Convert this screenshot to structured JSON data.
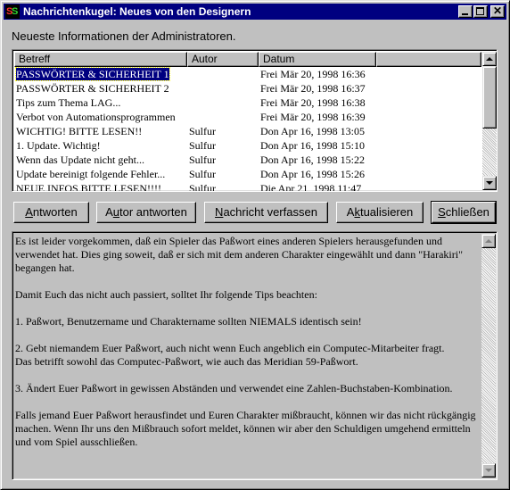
{
  "window": {
    "title": "Nachrichtenkugel: Neues von den Designern",
    "icon": "app-icon",
    "controls": [
      "minimize",
      "maximize",
      "close"
    ]
  },
  "intro": "Neueste Informationen der Administratoren.",
  "list": {
    "columns": [
      "Betreff",
      "Autor",
      "Datum"
    ],
    "rows": [
      {
        "subject": "PASSWÖRTER & SICHERHEIT 1",
        "author": "",
        "date": "Frei Mär 20, 1998 16:36",
        "selected": true
      },
      {
        "subject": "PASSWÖRTER & SICHERHEIT 2",
        "author": "",
        "date": "Frei Mär 20, 1998 16:37"
      },
      {
        "subject": "Tips zum Thema LAG...",
        "author": "",
        "date": "Frei Mär 20, 1998 16:38"
      },
      {
        "subject": "Verbot von Automationsprogrammen",
        "author": "",
        "date": "Frei Mär 20, 1998 16:39"
      },
      {
        "subject": "WICHTIG! BITTE LESEN!!",
        "author": "Sulfur",
        "date": "Don Apr 16, 1998 13:05"
      },
      {
        "subject": "1. Update. Wichtig!",
        "author": "Sulfur",
        "date": "Don Apr 16, 1998 15:10"
      },
      {
        "subject": "Wenn das Update nicht geht...",
        "author": "Sulfur",
        "date": "Don Apr 16, 1998 15:22"
      },
      {
        "subject": "Update bereinigt folgende Fehler...",
        "author": "Sulfur",
        "date": "Don Apr 16, 1998 15:26"
      },
      {
        "subject": "NEUE INFOS BITTE LESEN!!!!",
        "author": "Sulfur",
        "date": "Die Apr 21, 1998 11:47"
      }
    ]
  },
  "buttons": {
    "reply": "Antworten",
    "reply_author": "Autor antworten",
    "compose": "Nachricht verfassen",
    "refresh": "Aktualisieren",
    "close": "Schließen"
  },
  "message": [
    "Es ist leider vorgekommen, daß ein Spieler das Paßwort eines anderen Spielers herausgefunden und verwendet hat. Dies ging soweit, daß er sich mit dem anderen Charakter eingewählt und dann \"Harakiri\" begangen hat.",
    "Damit Euch das nicht auch passiert, solltet Ihr folgende Tips beachten:",
    "1. Paßwort, Benutzername und Charaktername sollten NIEMALS identisch sein!",
    "2. Gebt niemandem Euer Paßwort, auch nicht wenn Euch angeblich ein Computec-Mitarbeiter fragt.\nDas betrifft sowohl das Computec-Paßwort, wie auch das Meridian 59-Paßwort.",
    "3. Ändert Euer Paßwort in gewissen Abständen und verwendet eine Zahlen-Buchstaben-Kombination.",
    "Falls jemand Euer Paßwort herausfindet und Euren Charakter mißbraucht, können wir das nicht rückgängig machen. Wenn Ihr uns den Mißbrauch sofort meldet, können wir aber den Schuldigen umgehend ermitteln und vom Spiel ausschließen."
  ],
  "colors": {
    "titlebar": "#000080",
    "face": "#c0c0c0",
    "selection": "#000080"
  }
}
